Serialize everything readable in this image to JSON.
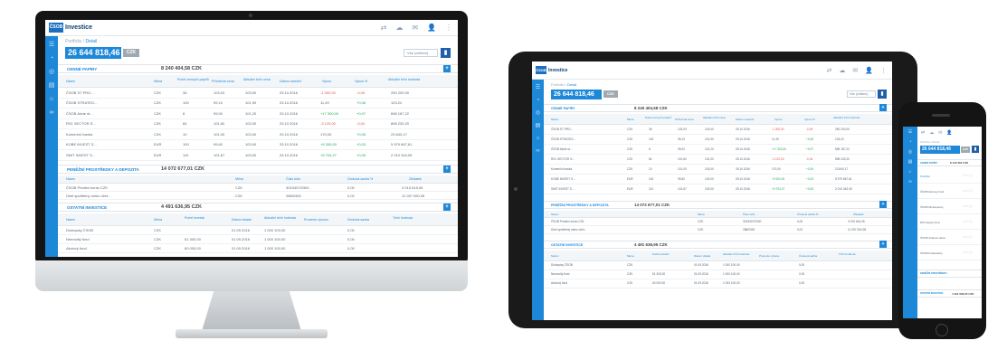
{
  "brand": {
    "name": "Investice",
    "mark": "ČSOB"
  },
  "breadcrumb": [
    "Portfolio",
    "Detail"
  ],
  "balance": {
    "amount": "26 644 818,46",
    "currency": "CZK"
  },
  "top_icons": [
    "transfer-icon",
    "cloud-icon",
    "messages-icon",
    "user-icon",
    "more-icon"
  ],
  "select_label": "Vše (celkem)",
  "sidebar_icons": [
    "menu-icon",
    "portfolio-icon",
    "coins-icon",
    "chart-icon",
    "building-icon",
    "link-icon"
  ],
  "sections": [
    {
      "title": "CENNÉ PAPÍRY",
      "total": "8 240 404,58 CZK",
      "columns": [
        "Název",
        "Měna",
        "Počet cenných papírů",
        "Průměrná cena",
        "Aktuální tržní cena",
        "Datum ocenění",
        "Výnos",
        "Výnos %",
        "Aktuální tržní hodnota"
      ],
      "rows": [
        [
          "ČSOB ST PRO...",
          "CZK",
          "36",
          "103,03",
          "103,00",
          "25.10.2016",
          "-1 000,00",
          "-0,05",
          "250 200,00"
        ],
        [
          "ČSOB STRATEG...",
          "CZK",
          "100",
          "99,10",
          "101,90",
          "25.10.2016",
          "11,49",
          "+0,06",
          "103,22"
        ],
        [
          "ČSOB Akcie st...",
          "CZK",
          "8",
          "99,00",
          "101,20",
          "25.10.2016",
          "+17 300,00",
          "+0,07",
          "696 187,22"
        ],
        [
          "RS1 SECTOR S...",
          "CZK",
          "84",
          "101,60",
          "102,00",
          "25.10.2016",
          "-3 120,00",
          "-0,04",
          "898 230,20"
        ],
        [
          "Komerční banka",
          "CZK",
          "10",
          "101,00",
          "103,00",
          "25.10.2016",
          "170,00",
          "+0,06",
          "23 840,17"
        ],
        [
          "KOBE INVEST S...",
          "EUR",
          "100",
          "99,60",
          "103,00",
          "25.10.2016",
          "+5 300,00",
          "+0,03",
          "5 979 667,61"
        ],
        [
          "SMIT INVEST S...",
          "EUR",
          "110",
          "101,67",
          "103,00",
          "25.10.2016",
          "+6 703,27",
          "+0,05",
          "2 010 343,05"
        ]
      ]
    },
    {
      "title": "PENĚŽNÍ PROSTŘEDKY A DEPOZITA",
      "total": "14 072 677,01 CZK",
      "columns": [
        "Název",
        "Měna",
        "Číslo účtu",
        "Úroková sazba %",
        "Zůstatek"
      ],
      "rows": [
        [
          "ČSOB Privátní konto CZK",
          "CZK",
          "3015307/0300",
          "0,00",
          "3 015 616,06"
        ],
        [
          "Účet spořitelny mimo účet...",
          "CZK",
          "288/0300",
          "0,02",
          "11 057 060,95"
        ]
      ]
    },
    {
      "title": "OSTATNÍ INVESTICE",
      "total": "4 491 636,95 CZK",
      "columns": [
        "Název",
        "Měna",
        "Počet investic",
        "Datum vkladu",
        "Aktuální tržní hodnota",
        "Procento výnosu",
        "Úroková sazba",
        "Tržní hodnota"
      ],
      "rows": [
        [
          "Dluhopisy ČSOB",
          "CZK",
          "",
          "01.09.2016",
          "1 000 100,00",
          "",
          "0,00",
          ""
        ],
        [
          "Nemovitý fond",
          "CZK",
          "61 300,00",
          "01.09.2016",
          "1 000 100,00",
          "",
          "0,00",
          ""
        ],
        [
          "Akciový fond",
          "CZK",
          "60 000,00",
          "01.09.2016",
          "1 000 100,00",
          "",
          "0,00",
          ""
        ]
      ]
    }
  ],
  "phone": {
    "title": "Portfolio / Detail",
    "sub_balance": "8 142 364 CZK",
    "menu_items": [
      "Portfolio",
      "ČSOB Akciový fond",
      "ČSOB Dluhopisový",
      "RS1 Equity fund",
      "ČSOB Světové akcie",
      "ČSOB Krátkodobý"
    ],
    "footer_items": [
      "PENĚŽNÍ PROSTŘEDKY",
      "OSTATNÍ INVESTICE"
    ],
    "footer_totals": [
      "",
      ""
    ]
  }
}
